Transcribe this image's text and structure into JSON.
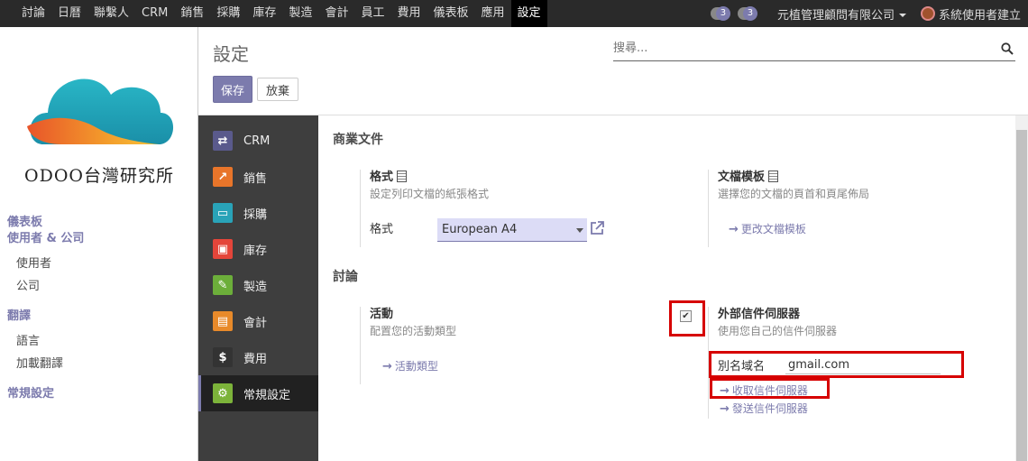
{
  "topbar": {
    "menu": [
      "討論",
      "日曆",
      "聯繫人",
      "CRM",
      "銷售",
      "採購",
      "庫存",
      "製造",
      "會計",
      "員工",
      "費用",
      "儀表板",
      "應用",
      "設定"
    ],
    "active": "設定",
    "activity_count": "3",
    "message_count": "3",
    "company": "元植管理顧問有限公司",
    "user": "系統使用者建立",
    "accent": "#7c7bad"
  },
  "sidebar": {
    "logo_text": "ODOO台灣研究所",
    "sections": [
      {
        "head": "儀表板",
        "items": []
      },
      {
        "head": "使用者 & 公司",
        "items": [
          "使用者",
          "公司"
        ]
      },
      {
        "head": "翻譯",
        "items": [
          "語言",
          "加載翻譯"
        ]
      },
      {
        "head": "常規設定",
        "items": []
      }
    ]
  },
  "control": {
    "title": "設定",
    "search_placeholder": "搜尋...",
    "save_label": "保存",
    "discard_label": "放棄"
  },
  "apps": [
    {
      "name": "CRM",
      "icon": "handshake-icon",
      "color": "#5a5a8c"
    },
    {
      "name": "銷售",
      "icon": "chart-line-icon",
      "color": "#e8752a"
    },
    {
      "name": "採購",
      "icon": "credit-card-icon",
      "color": "#29a3b8"
    },
    {
      "name": "庫存",
      "icon": "warehouse-icon",
      "color": "#e4453a"
    },
    {
      "name": "製造",
      "icon": "wrench-icon",
      "color": "#6cae3a"
    },
    {
      "name": "會計",
      "icon": "document-icon",
      "color": "#e88a2a"
    },
    {
      "name": "費用",
      "icon": "dollar-icon",
      "color": "#333333"
    },
    {
      "name": "常規設定",
      "icon": "gear-icon",
      "color": "#7cb33a",
      "active": true
    }
  ],
  "content": {
    "business_docs": {
      "title": "商業文件",
      "format": {
        "title": "格式",
        "desc": "設定列印文檔的紙張格式",
        "field_label": "格式",
        "value": "European A4"
      },
      "template": {
        "title": "文檔模板",
        "desc": "選擇您的文檔的頁首和頁尾佈局",
        "link": "更改文檔模板"
      }
    },
    "discussion": {
      "title": "討論",
      "activity": {
        "title": "活動",
        "desc": "配置您的活動類型",
        "link": "活動類型"
      },
      "external_mail": {
        "title": "外部信件伺服器",
        "desc": "使用您自己的信件伺服器",
        "checked": true,
        "alias_label": "別名域名",
        "alias_value": "gmail.com",
        "incoming_link": "收取信件伺服器",
        "outgoing_link": "發送信件伺服器"
      }
    }
  }
}
